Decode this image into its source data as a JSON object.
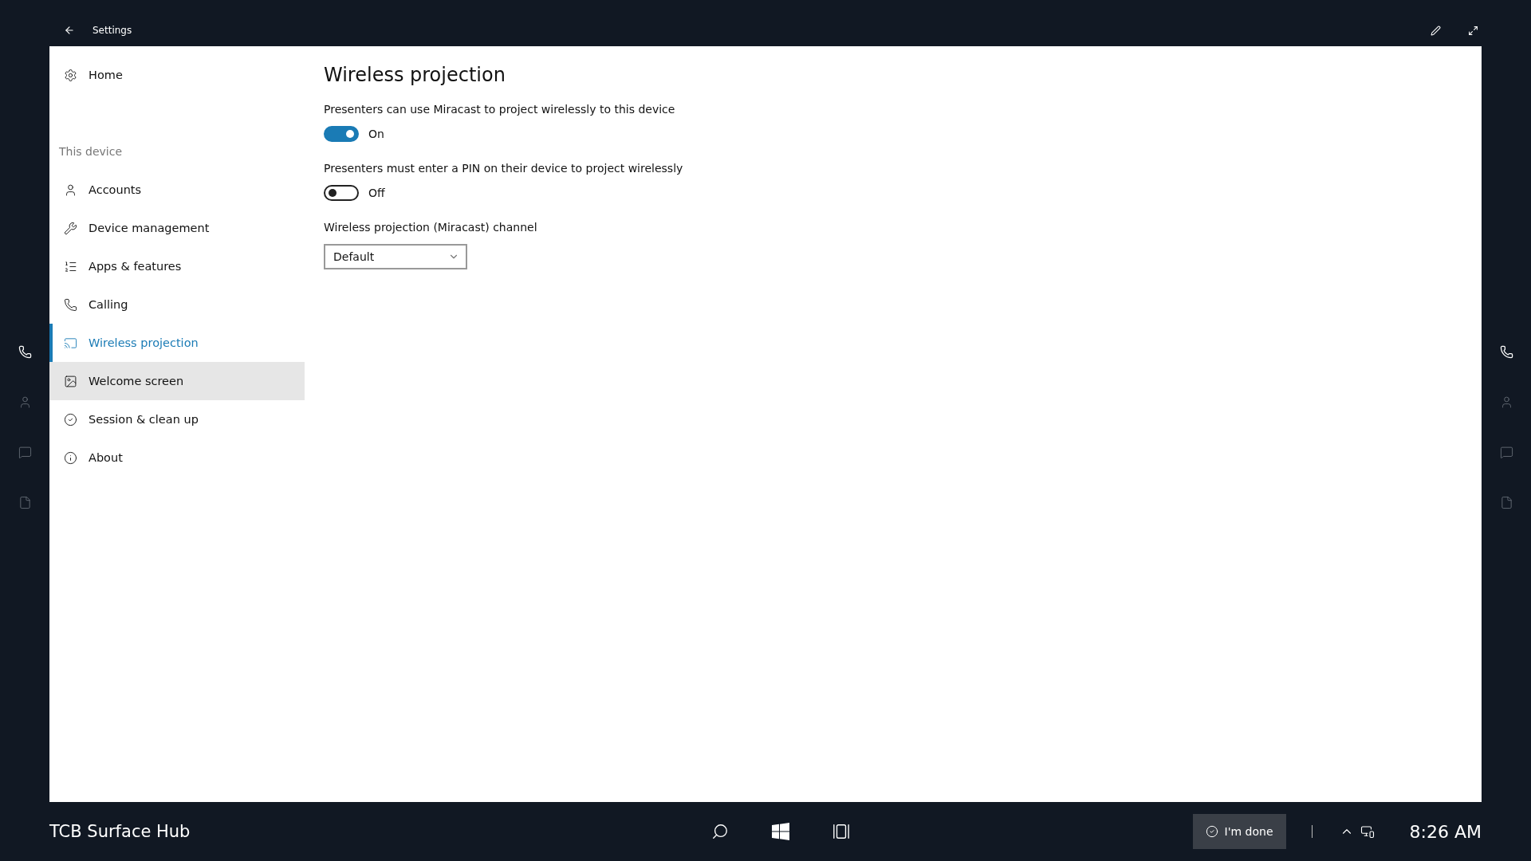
{
  "title_bar": {
    "title": "Settings"
  },
  "left_rail": [
    {
      "selected": true
    },
    {
      "selected": false
    },
    {
      "selected": false
    },
    {
      "selected": false
    }
  ],
  "right_rail": [
    {
      "selected": true
    },
    {
      "selected": false
    },
    {
      "selected": false
    },
    {
      "selected": false
    }
  ],
  "sidebar": {
    "home": "Home",
    "section": "This device",
    "items": [
      {
        "label": "Accounts",
        "selected": false,
        "hovered": false
      },
      {
        "label": "Device management",
        "selected": false,
        "hovered": false
      },
      {
        "label": "Apps & features",
        "selected": false,
        "hovered": false
      },
      {
        "label": "Calling",
        "selected": false,
        "hovered": false
      },
      {
        "label": "Wireless projection",
        "selected": true,
        "hovered": false
      },
      {
        "label": "Welcome screen",
        "selected": false,
        "hovered": true
      },
      {
        "label": "Session & clean up",
        "selected": false,
        "hovered": false
      },
      {
        "label": "About",
        "selected": false,
        "hovered": false
      }
    ]
  },
  "content": {
    "title": "Wireless projection",
    "toggles": [
      {
        "label": "Presenters can use Miracast to project wirelessly to this device",
        "on": true,
        "state_text": "On"
      },
      {
        "label": "Presenters must enter a PIN on their device to project wirelessly",
        "on": false,
        "state_text": "Off"
      }
    ],
    "dropdown": {
      "label": "Wireless projection (Miracast) channel",
      "value": "Default"
    }
  },
  "taskbar": {
    "device_name": "TCB Surface Hub",
    "done_button": "I'm done",
    "time": "8:26 AM"
  }
}
